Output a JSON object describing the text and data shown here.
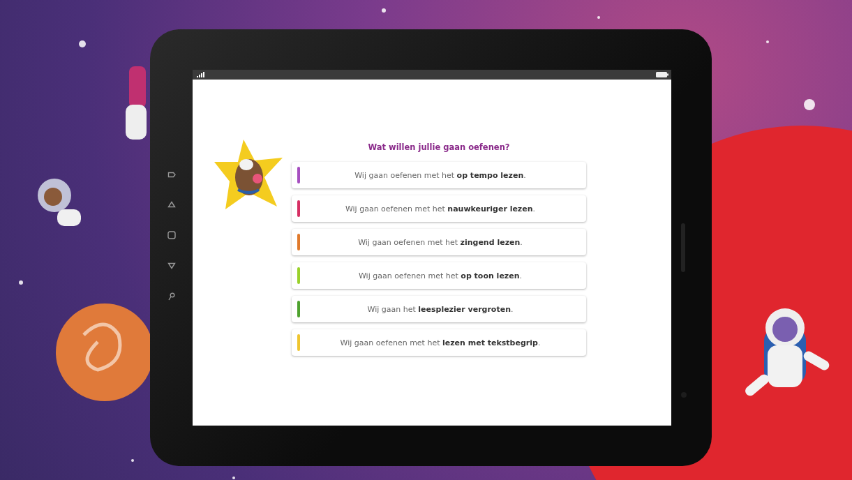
{
  "question": {
    "title": "Wat willen jullie gaan oefenen?"
  },
  "options": [
    {
      "text": "Wij gaan oefenen met het **op tempo lezen**.",
      "color": "#a64fc0"
    },
    {
      "text": "Wij gaan oefenen met het **nauwkeuriger lezen**.",
      "color": "#d62f63"
    },
    {
      "text": "Wij gaan oefenen met het **zingend lezen**.",
      "color": "#e07a2c"
    },
    {
      "text": "Wij gaan oefenen met het **op toon lezen**.",
      "color": "#9ad12b"
    },
    {
      "text": "Wij gaan het **leesplezier vergroten**.",
      "color": "#4ea22e"
    },
    {
      "text": "Wij gaan oefenen met het **lezen met tekstbegrip**.",
      "color": "#efc52f"
    }
  ]
}
